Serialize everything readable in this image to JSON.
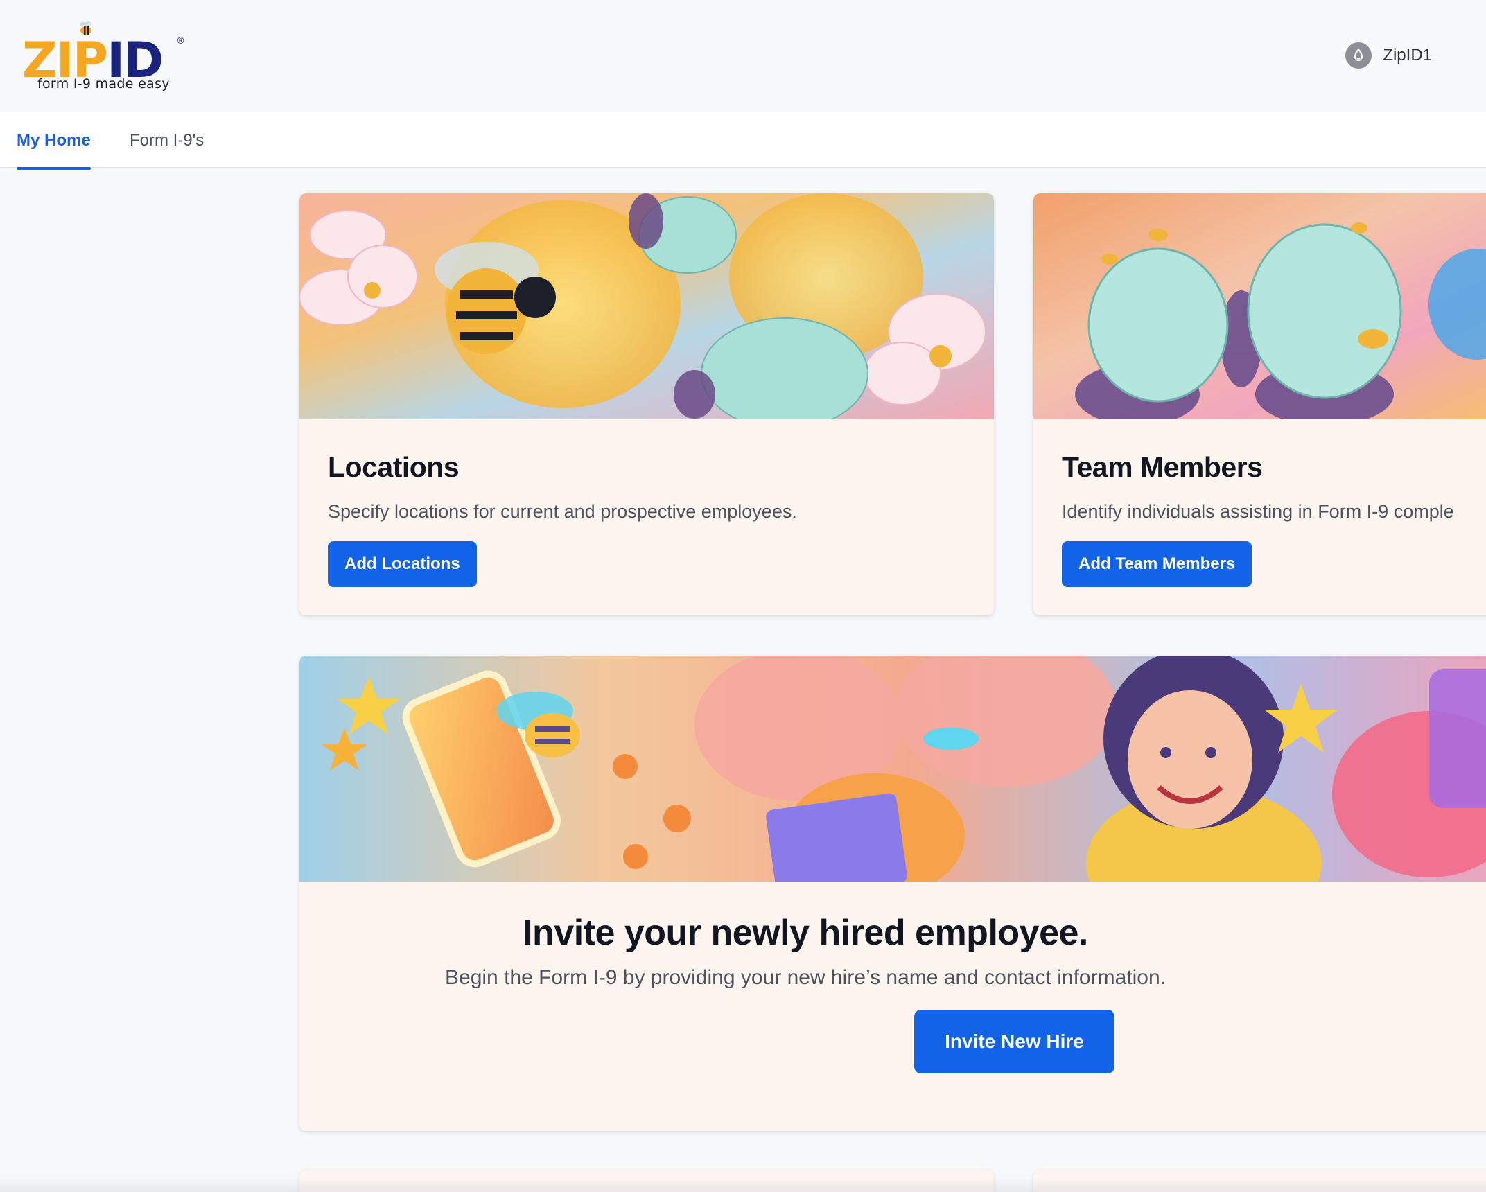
{
  "brand": {
    "logo_zip": "ZIP",
    "logo_id": "ID",
    "registered_mark": "®",
    "tagline": "form I-9 made easy",
    "colors": {
      "zip": "#f5a623",
      "id": "#1a237e"
    }
  },
  "user": {
    "name": "ZipID1",
    "icon": "user-avatar-icon"
  },
  "nav": {
    "tabs": [
      {
        "label": "My Home",
        "active": true
      },
      {
        "label": "Form I-9's",
        "active": false
      }
    ],
    "accent": "#1f5fd1"
  },
  "cards": {
    "locations": {
      "title": "Locations",
      "description": "Specify locations for current and prospective employees.",
      "button": "Add Locations"
    },
    "team": {
      "title": "Team Members",
      "description": "Identify individuals assisting in Form I-9 comple",
      "button": "Add Team Members"
    },
    "invite": {
      "title": "Invite your newly hired employee.",
      "description": "Begin the Form I-9 by providing your new hire’s name and contact information.",
      "button": "Invite New Hire"
    }
  },
  "theme": {
    "button_bg": "#1263e8",
    "card_bg": "#fdf5ee",
    "page_bg": "#f7f8fa"
  }
}
